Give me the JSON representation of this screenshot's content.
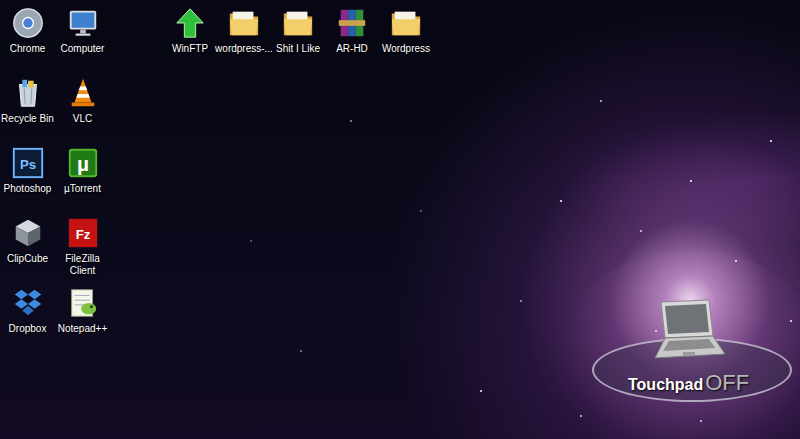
{
  "desktop": {
    "left_icons": [
      {
        "label": "Chrome",
        "kind": "chrome"
      },
      {
        "label": "Computer",
        "kind": "computer"
      },
      {
        "label": "Recycle Bin",
        "kind": "recycle"
      },
      {
        "label": "VLC",
        "kind": "vlc"
      },
      {
        "label": "Photoshop",
        "kind": "photoshop",
        "glyph": "Ps"
      },
      {
        "label": "µTorrent",
        "kind": "utorrent",
        "glyph": "µ"
      },
      {
        "label": "ClipCube",
        "kind": "clipcube"
      },
      {
        "label": "FileZilla Client",
        "kind": "filezilla",
        "glyph": "Fz"
      },
      {
        "label": "Dropbox",
        "kind": "dropbox"
      },
      {
        "label": "Notepad++",
        "kind": "notepad"
      }
    ],
    "top_icons": [
      {
        "label": "WinFTP",
        "kind": "winftp"
      },
      {
        "label": "wordpress-...",
        "kind": "folder"
      },
      {
        "label": "Shit I Like",
        "kind": "folder"
      },
      {
        "label": "AR-HD",
        "kind": "winrar"
      },
      {
        "label": "Wordpress",
        "kind": "folder"
      }
    ]
  },
  "osd": {
    "label": "Touchpad",
    "state": "OFF"
  }
}
